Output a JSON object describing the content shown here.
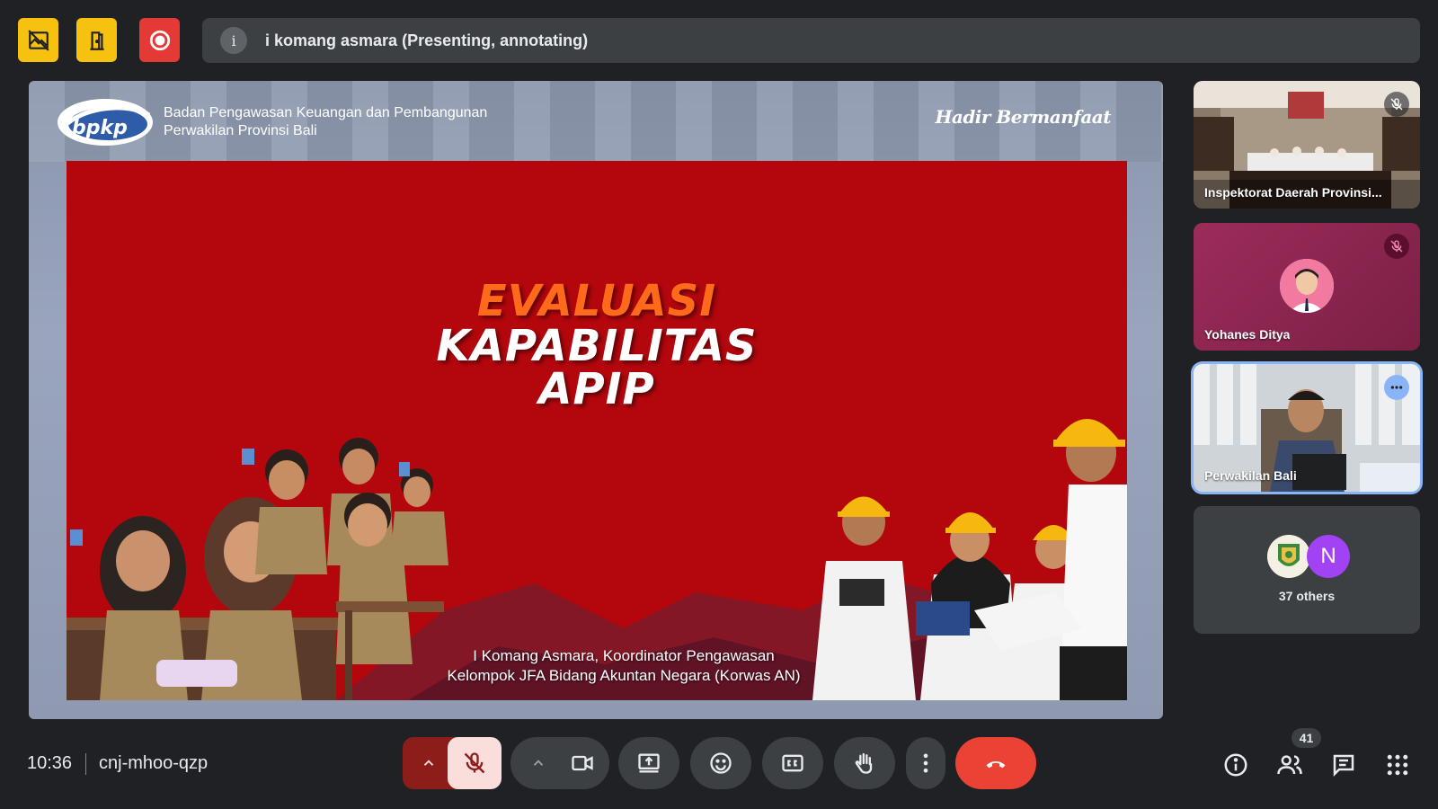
{
  "topbar": {
    "presenter_text": "i komang asmara (Presenting, annotating)",
    "info_label": "i",
    "colors": {
      "yellow": "#f6c10f",
      "red": "#e53935"
    }
  },
  "slide": {
    "org_line1": "Badan Pengawasan Keuangan dan Pembangunan",
    "org_line2": "Perwakilan Provinsi Bali",
    "logo_text": "bpkp",
    "tagline": "Hadir Bermanfaat",
    "title_line1": "EVALUASI",
    "title_line2": "KAPABILITAS",
    "title_line3": "APIP",
    "credit_line1": "I Komang Asmara, Koordinator Pengawasan",
    "credit_line2": "Kelompok JFA Bidang Akuntan Negara (Korwas AN)"
  },
  "participants": [
    {
      "name": "Inspektorat Daerah Provinsi...",
      "muted": true
    },
    {
      "name": "Yohanes Ditya",
      "muted": true
    },
    {
      "name": "Perwakilan Bali",
      "muted": false
    },
    {
      "others_label": "37 others",
      "avatar_letter": "N"
    }
  ],
  "bottombar": {
    "time": "10:36",
    "meeting_code": "cnj-mhoo-qzp",
    "participant_count": "41"
  }
}
